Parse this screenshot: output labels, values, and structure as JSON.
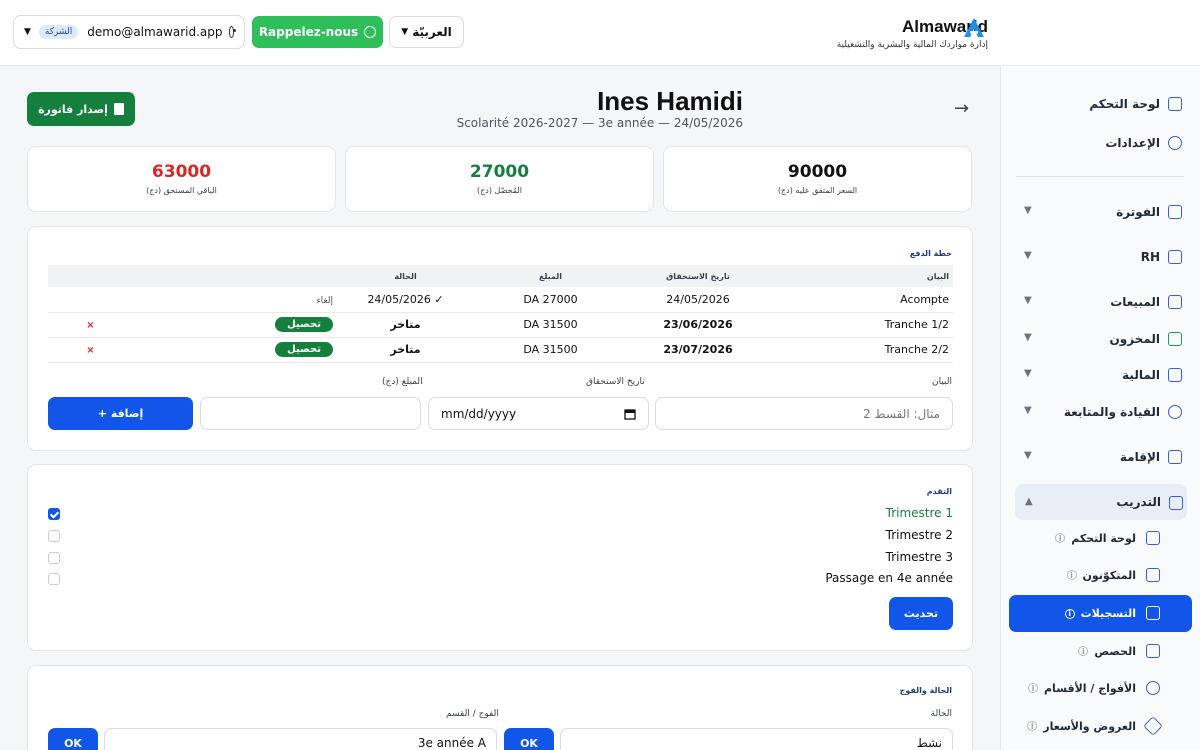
{
  "topbar": {
    "user_email": "demo@almawarid.app",
    "company_badge": "الشركة",
    "callback_label": "Rappelez-nous",
    "language": "العربيّة",
    "brand_name": "Almawarid",
    "brand_tagline": "إدارة مواردك المالية والبشرية والتشغيلية"
  },
  "header": {
    "student_name": "Ines Hamidi",
    "subtitle": "Scolarité 2026-2027 — 3e année — 24/05/2026",
    "invoice_button": "إصدار فاتورة"
  },
  "stats": [
    {
      "value": "90000",
      "label": "السعر المتفق عليه (دج)",
      "color": "#111111"
    },
    {
      "value": "27000",
      "label": "المُحصّل (دج)",
      "color": "#15803d"
    },
    {
      "value": "63000",
      "label": "الباقي المستحق (دج)",
      "color": "#dc2626"
    }
  ],
  "payment_plan": {
    "title": "خطة الدفع",
    "columns": {
      "label": "البيان",
      "due": "تاريخ الاستحقاق",
      "amount": "المبلغ",
      "status": "الحالة"
    },
    "rows": [
      {
        "label": "Acompte",
        "due": "24/05/2026",
        "amount": "DA 27000",
        "status": "24/05/2026 ✓",
        "action": "إلغاء"
      },
      {
        "label": "Tranche 1/2",
        "due": "23/06/2026",
        "amount": "DA 31500",
        "status": "متاخر",
        "action": "تحصيل",
        "remove": "×"
      },
      {
        "label": "Tranche 2/2",
        "due": "23/07/2026",
        "amount": "DA 31500",
        "status": "متاخر",
        "action": "تحصيل",
        "remove": "×"
      }
    ],
    "form": {
      "label_label": "البيان",
      "label_placeholder": "مثال: القسط 2",
      "due_label": "تاريخ الاستحقاق",
      "due_placeholder": "mm/dd/yyyy",
      "amount_label": "المبلغ (دج)",
      "add_button": "+ إضافة"
    }
  },
  "progress": {
    "title": "التقدم",
    "items": [
      {
        "label": "Trimestre 1",
        "checked": true
      },
      {
        "label": "Trimestre 2",
        "checked": false
      },
      {
        "label": "Trimestre 3",
        "checked": false
      },
      {
        "label": "Passage en 4e année",
        "checked": false
      }
    ],
    "update_button": "تحديث"
  },
  "status_group": {
    "title": "الحالة والفوج",
    "status_label": "الحالة",
    "status_value": "نشط",
    "group_label": "الفوج / القسم",
    "group_value": "3e année A",
    "ok_label": "OK"
  },
  "sidebar": {
    "top_items": [
      {
        "label": "لوحة التحكم",
        "icon": "dashboard-icon"
      },
      {
        "label": "الإعدادات",
        "icon": "gear-icon"
      }
    ],
    "sections": [
      {
        "label": "الفوترة",
        "icon": "invoice-icon"
      },
      {
        "label": "RH",
        "icon": "users-icon"
      },
      {
        "label": "المبيعات",
        "icon": "cart-icon"
      },
      {
        "label": "المخزون",
        "icon": "boxes-icon"
      },
      {
        "label": "المالية",
        "icon": "truck-icon"
      },
      {
        "label": "القيادة والمتابعة",
        "icon": "chart-pie-icon"
      },
      {
        "label": "الإقامة",
        "icon": "door-icon"
      },
      {
        "label": "التدريب",
        "icon": "graduation-cap-icon"
      }
    ],
    "training_sub": [
      {
        "label": "لوحة التحكم",
        "icon": "dashboard-icon"
      },
      {
        "label": "المتكوّنون",
        "icon": "users-icon"
      },
      {
        "label": "التسجيلات",
        "icon": "clipboard-icon",
        "active": true
      },
      {
        "label": "الحصص",
        "icon": "calendar-icon"
      },
      {
        "label": "الأفواج / الأقسام",
        "icon": "group-icon"
      },
      {
        "label": "العروض والأسعار",
        "icon": "tag-icon"
      }
    ],
    "accent_color": "#1156e8"
  }
}
